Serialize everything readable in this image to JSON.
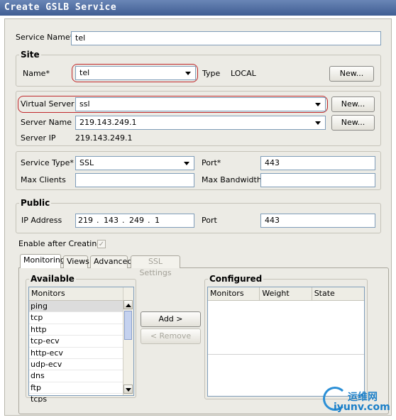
{
  "window": {
    "title": "Create GSLB Service"
  },
  "service_name": {
    "label": "Service Name*",
    "value": "tel"
  },
  "site": {
    "title": "Site",
    "name_label": "Name*",
    "name_value": "tel",
    "type_label": "Type",
    "type_value": "LOCAL",
    "new_button": "New..."
  },
  "vserver": {
    "vs_label": "Virtual Server",
    "vs_value": "ssl",
    "vs_new": "New...",
    "server_name_label": "Server Name",
    "server_name_value": "219.143.249.1",
    "server_new": "New...",
    "server_ip_label": "Server IP",
    "server_ip_value": "219.143.249.1"
  },
  "service": {
    "type_label": "Service Type*",
    "type_value": "SSL",
    "port_label": "Port*",
    "port_value": "443",
    "max_clients_label": "Max Clients",
    "max_clients_value": "",
    "max_bw_label": "Max Bandwidth",
    "max_bw_value": ""
  },
  "public": {
    "title": "Public",
    "ip_label": "IP Address",
    "ip_octets": [
      "219",
      "143",
      "249",
      "1"
    ],
    "ip_dot": ".",
    "port_label": "Port",
    "port_value": "443"
  },
  "enable_after": {
    "label": "Enable after Creating",
    "check": "✓"
  },
  "tabs": [
    {
      "label": "Monitoring"
    },
    {
      "label": "Views"
    },
    {
      "label": "Advanced"
    },
    {
      "label": "SSL Settings"
    }
  ],
  "available": {
    "title": "Available",
    "header": "Monitors",
    "items": [
      "ping",
      "tcp",
      "http",
      "tcp-ecv",
      "http-ecv",
      "udp-ecv",
      "dns",
      "ftp",
      "tcps"
    ]
  },
  "buttons": {
    "add": "Add >",
    "remove": "< Remove"
  },
  "configured": {
    "title": "Configured",
    "columns": [
      "Monitors",
      "Weight",
      "State"
    ]
  },
  "watermark": {
    "cn": "运维网",
    "url": "iyunv.com"
  }
}
